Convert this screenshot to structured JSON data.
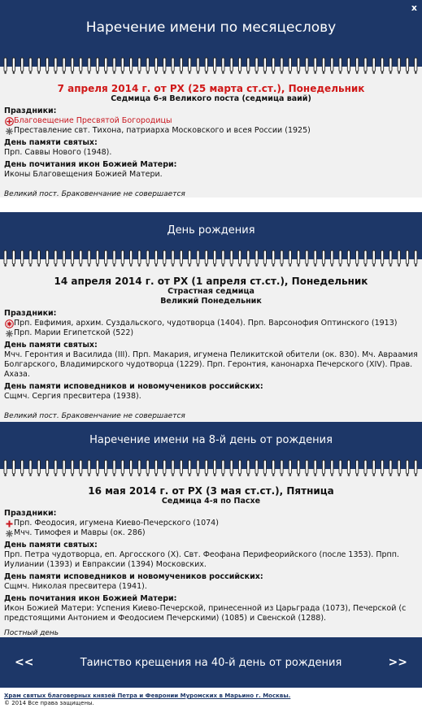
{
  "header": {
    "title": "Наречение имени по месяцеслову",
    "close_label": "x"
  },
  "day1": {
    "title": "7 апреля 2014 г. от РХ (25 марта ст.ст.), Понедельник",
    "subtitle": "Седмица 6-я Великого поста (седмица ваий)",
    "feasts_heading": "Праздники:",
    "feasts": [
      {
        "icon": "great-feast-icon",
        "text": "Благовещение Пресвятой Богородицы"
      },
      {
        "icon": "saint-cross-icon",
        "text": "Преставление свт. Тихона, патриарха Московского и всея России (1925)"
      }
    ],
    "saints_heading": "День памяти святых:",
    "saints": "Прп. Саввы Нового (1948).",
    "icons_heading": "День почитания икон Божией Матери:",
    "icons_text": "Иконы Благовещения Божией Матери.",
    "note": "Великий пост. Браковенчание не совершается"
  },
  "birthday_banner": "День рождения",
  "day2": {
    "title": "14 апреля 2014 г. от РХ (1 апреля ст.ст.), Понедельник",
    "subtitle1": "Страстная седмица",
    "subtitle2": "Великий Понедельник",
    "feasts_heading": "Праздники:",
    "feasts": [
      {
        "icon": "polyeleos-icon",
        "text": "Прп. Евфимия, архим. Суздальского, чудотворца (1404). Прп. Варсонофия Оптинского (1913)"
      },
      {
        "icon": "saint-cross-icon",
        "text": "Прп. Марии Египетской (522)"
      }
    ],
    "saints_heading": "День памяти святых:",
    "saints": "Мчч. Геронтия и Василида (III). Прп. Макария, игумена Пеликитской обители (ок. 830). Мч. Авраамия Болгарского, Владимирского чудотворца (1229). Прп. Геронтия, канонарха Печерского (XIV). Прав. Ахаза.",
    "confessors_heading": "День памяти исповедников и новомучеников российских:",
    "confessors": "Сщмч. Сергия пресвитера (1938).",
    "note": "Великий пост. Браковенчание не совершается"
  },
  "eighth_day_banner": "Наречение имени на 8-й день от рождения",
  "day3": {
    "title": "16 мая 2014 г. от РХ (3 мая ст.ст.), Пятница",
    "subtitle": "Седмица 4-я по Пасхе",
    "feasts_heading": "Праздники:",
    "feasts": [
      {
        "icon": "red-cross-icon",
        "text": "Прп. Феодосия, игумена Киево-Печерского (1074)"
      },
      {
        "icon": "saint-cross-icon",
        "text": "Мчч. Тимофея и Мавры (ок. 286)"
      }
    ],
    "saints_heading": "День памяти святых:",
    "saints": "Прп. Петра чудотворца, еп. Аргосского (X). Свт. Феофана Перифеорийского (после 1353). Прпп. Иулиании (1393) и Евпраксии (1394) Московских.",
    "confessors_heading": "День памяти исповедников и новомучеников российских:",
    "confessors": "Сщмч. Николая пресвитера (1941).",
    "icons_heading": "День почитания икон Божией Матери:",
    "icons_text": "Икон Божией Матери: Успения Киево-Печерской, принесенной из Царьграда (1073), Печерской (с предстоящими Антонием и Феодосием Печерскими) (1085) и Свенской (1288).",
    "note": "Постный день"
  },
  "nav": {
    "prev": "<<",
    "label": "Таинство крещения на 40-й день от рождения",
    "next": ">>"
  },
  "footer": {
    "link": "Храм святых благоверных князей Петра и Февронии Муромских в Марьино г. Москвы.",
    "copyright": "© 2014 Все права защищены."
  },
  "colors": {
    "banner": "#1d3768",
    "red": "#d01818",
    "panel": "#f1f1f1"
  }
}
